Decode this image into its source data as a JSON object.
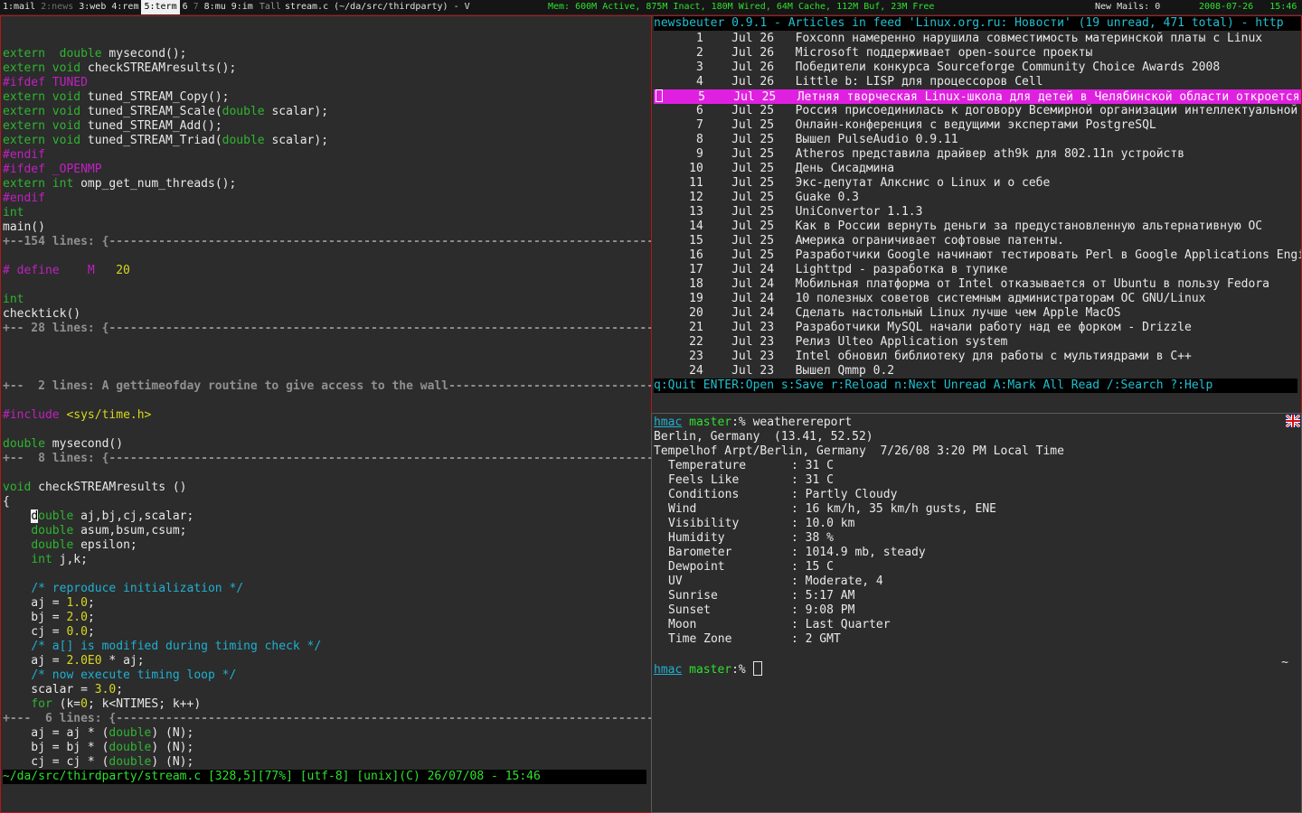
{
  "topbar": {
    "tags": [
      {
        "label": "1:mail",
        "state": "normal"
      },
      {
        "label": "2:news",
        "state": "dim"
      },
      {
        "label": "3:web",
        "state": "normal"
      },
      {
        "label": "4:rem",
        "state": "normal"
      },
      {
        "label": "5:term",
        "state": "active"
      },
      {
        "label": "6",
        "state": "normal"
      },
      {
        "label": "7",
        "state": "dim"
      },
      {
        "label": "8:mu",
        "state": "normal"
      },
      {
        "label": "9:im",
        "state": "normal"
      }
    ],
    "layout": "Tall",
    "window_title": "stream.c (~/da/src/thirdparty) - V",
    "memory": "Mem: 600M Active, 875M Inact, 180M Wired, 64M Cache, 112M Buf, 23M Free",
    "mails": "New Mails:  0",
    "date": "2008-07-26",
    "time": "15:46"
  },
  "editor": {
    "lines": [
      [],
      [
        [
          "kw",
          "extern"
        ],
        [
          "",
          "  "
        ],
        [
          "kw",
          "double"
        ],
        [
          "",
          " mysecond();"
        ]
      ],
      [
        [
          "kw",
          "extern"
        ],
        [
          "",
          " "
        ],
        [
          "kw",
          "void"
        ],
        [
          "",
          " checkSTREAMresults();"
        ]
      ],
      [
        [
          "pp",
          "#ifdef TUNED"
        ]
      ],
      [
        [
          "kw",
          "extern"
        ],
        [
          "",
          " "
        ],
        [
          "kw",
          "void"
        ],
        [
          "",
          " tuned_STREAM_Copy();"
        ]
      ],
      [
        [
          "kw",
          "extern"
        ],
        [
          "",
          " "
        ],
        [
          "kw",
          "void"
        ],
        [
          "",
          " tuned_STREAM_Scale("
        ],
        [
          "kw",
          "double"
        ],
        [
          "",
          " scalar);"
        ]
      ],
      [
        [
          "kw",
          "extern"
        ],
        [
          "",
          " "
        ],
        [
          "kw",
          "void"
        ],
        [
          "",
          " tuned_STREAM_Add();"
        ]
      ],
      [
        [
          "kw",
          "extern"
        ],
        [
          "",
          " "
        ],
        [
          "kw",
          "void"
        ],
        [
          "",
          " tuned_STREAM_Triad("
        ],
        [
          "kw",
          "double"
        ],
        [
          "",
          " scalar);"
        ]
      ],
      [
        [
          "pp",
          "#endif"
        ]
      ],
      [
        [
          "pp",
          "#ifdef _OPENMP"
        ]
      ],
      [
        [
          "kw",
          "extern"
        ],
        [
          "",
          " "
        ],
        [
          "kw",
          "int"
        ],
        [
          "",
          " omp_get_num_threads();"
        ]
      ],
      [
        [
          "pp",
          "#endif"
        ]
      ],
      [
        [
          "kw",
          "int"
        ]
      ],
      [
        [
          "",
          "main()"
        ]
      ],
      [
        [
          "fold",
          "+--154 lines: {-----------------------------------------------------------------------------------"
        ]
      ],
      [],
      [
        [
          "pp",
          "# define    M   "
        ],
        [
          "num",
          "20"
        ]
      ],
      [],
      [
        [
          "kw",
          "int"
        ]
      ],
      [
        [
          "",
          "checktick()"
        ]
      ],
      [
        [
          "fold",
          "+-- 28 lines: {-----------------------------------------------------------------------------------"
        ]
      ],
      [],
      [],
      [],
      [
        [
          "fold",
          "+--  2 lines: A gettimeofday routine to give access to the wall-----------------------------------"
        ]
      ],
      [],
      [
        [
          "pp",
          "#include "
        ],
        [
          "num",
          "<sys/time.h>"
        ]
      ],
      [],
      [
        [
          "kw",
          "double"
        ],
        [
          "",
          " mysecond()"
        ]
      ],
      [
        [
          "fold",
          "+--  8 lines: {-----------------------------------------------------------------------------------"
        ]
      ],
      [],
      [
        [
          "kw",
          "void"
        ],
        [
          "",
          " checkSTREAMresults ()"
        ]
      ],
      [
        [
          "",
          "{"
        ]
      ],
      [
        [
          "",
          "    "
        ],
        [
          "cursor",
          "d"
        ],
        [
          "kw",
          "ouble"
        ],
        [
          "",
          " aj,bj,cj,scalar;"
        ]
      ],
      [
        [
          "",
          "    "
        ],
        [
          "kw",
          "double"
        ],
        [
          "",
          " asum,bsum,csum;"
        ]
      ],
      [
        [
          "",
          "    "
        ],
        [
          "kw",
          "double"
        ],
        [
          "",
          " epsilon;"
        ]
      ],
      [
        [
          "",
          "    "
        ],
        [
          "kw",
          "int"
        ],
        [
          "",
          " j,k;"
        ]
      ],
      [],
      [
        [
          "",
          "    "
        ],
        [
          "cm",
          "/* reproduce initialization */"
        ]
      ],
      [
        [
          "",
          "    aj = "
        ],
        [
          "num",
          "1.0"
        ],
        [
          "",
          ";"
        ]
      ],
      [
        [
          "",
          "    bj = "
        ],
        [
          "num",
          "2.0"
        ],
        [
          "",
          ";"
        ]
      ],
      [
        [
          "",
          "    cj = "
        ],
        [
          "num",
          "0.0"
        ],
        [
          "",
          ";"
        ]
      ],
      [
        [
          "",
          "    "
        ],
        [
          "cm",
          "/* a[] is modified during timing check */"
        ]
      ],
      [
        [
          "",
          "    aj = "
        ],
        [
          "num",
          "2.0E0"
        ],
        [
          "",
          " * aj;"
        ]
      ],
      [
        [
          "",
          "    "
        ],
        [
          "cm",
          "/* now execute timing loop */"
        ]
      ],
      [
        [
          "",
          "    scalar = "
        ],
        [
          "num",
          "3.0"
        ],
        [
          "",
          ";"
        ]
      ],
      [
        [
          "",
          "    "
        ],
        [
          "kw",
          "for"
        ],
        [
          "",
          " (k="
        ],
        [
          "num",
          "0"
        ],
        [
          "",
          "; k<NTIMES; k++)"
        ]
      ],
      [
        [
          "fold",
          "+---  6 lines: {----------------------------------------------------------------------------------"
        ]
      ],
      [
        [
          "",
          "    aj = aj * ("
        ],
        [
          "kw",
          "double"
        ],
        [
          "",
          ") (N);"
        ]
      ],
      [
        [
          "",
          "    bj = bj * ("
        ],
        [
          "kw",
          "double"
        ],
        [
          "",
          ") (N);"
        ]
      ],
      [
        [
          "",
          "    cj = cj * ("
        ],
        [
          "kw",
          "double"
        ],
        [
          "",
          ") (N);"
        ]
      ]
    ],
    "statusline": "~/da/src/thirdparty/stream.c [328,5][77%] [utf-8] [unix](C) 26/07/08 - 15:46"
  },
  "newsbeuter": {
    "title": "newsbeuter 0.9.1 - Articles in feed 'Linux.org.ru: Новости' (19 unread, 471 total) - http",
    "articles": [
      {
        "n": "1",
        "date": "Jul 26",
        "title": "Foxconn намеренно нарушила совместимость материнской платы с Linux"
      },
      {
        "n": "2",
        "date": "Jul 26",
        "title": "Microsoft поддерживает open-source проекты"
      },
      {
        "n": "3",
        "date": "Jul 26",
        "title": "Победители конкурса Sourceforge Community Choice Awards 2008"
      },
      {
        "n": "4",
        "date": "Jul 26",
        "title": "Little b: LISP для процессоров Cell"
      },
      {
        "n": "5",
        "date": "Jul 25",
        "title": "Летняя творческая Linux-школа для детей в Челябинской области откроется"
      },
      {
        "n": "6",
        "date": "Jul 25",
        "title": "Россия присоединилась к договору Всемирной организации интеллектуальной"
      },
      {
        "n": "7",
        "date": "Jul 25",
        "title": "Онлайн-конференция с ведущими экспертами PostgreSQL"
      },
      {
        "n": "8",
        "date": "Jul 25",
        "title": "Вышел PulseAudio 0.9.11"
      },
      {
        "n": "9",
        "date": "Jul 25",
        "title": "Atheros представила драйвер ath9k для 802.11n устройств"
      },
      {
        "n": "10",
        "date": "Jul 25",
        "title": "День Сисадмина"
      },
      {
        "n": "11",
        "date": "Jul 25",
        "title": "Экс-депутат Алкснис о Linux и о себе"
      },
      {
        "n": "12",
        "date": "Jul 25",
        "title": "Guake 0.3"
      },
      {
        "n": "13",
        "date": "Jul 25",
        "title": "UniConvertor 1.1.3"
      },
      {
        "n": "14",
        "date": "Jul 25",
        "title": "Как в России вернуть деньги за предустановленную альтернативную ОС"
      },
      {
        "n": "15",
        "date": "Jul 25",
        "title": "Америка ограничивает софтовые патенты."
      },
      {
        "n": "16",
        "date": "Jul 25",
        "title": "Разработчики Google начинают тестировать Perl в Google Applications Engi"
      },
      {
        "n": "17",
        "date": "Jul 24",
        "title": "Lighttpd - разработка в тупике"
      },
      {
        "n": "18",
        "date": "Jul 24",
        "title": "Мобильная платформа от Intel отказывается от Ubuntu в пользу Fedora"
      },
      {
        "n": "19",
        "date": "Jul 24",
        "title": "10 полезных советов системным администраторам ОС GNU/Linux"
      },
      {
        "n": "20",
        "date": "Jul 24",
        "title": "Сделать настольный Linux лучше чем Apple MacOS"
      },
      {
        "n": "21",
        "date": "Jul 23",
        "title": "Разработчики MySQL начали работу над ее форком - Drizzle"
      },
      {
        "n": "22",
        "date": "Jul 23",
        "title": "Релиз Ulteo Application system"
      },
      {
        "n": "23",
        "date": "Jul 23",
        "title": "Intel обновил библиотеку для работы с мультиядрами в C++"
      },
      {
        "n": "24",
        "date": "Jul 23",
        "title": "Вышел Qmmp 0.2"
      }
    ],
    "selected_index": 4,
    "help": "q:Quit ENTER:Open s:Save r:Reload n:Next Unread A:Mark All Read /:Search ?:Help"
  },
  "terminal": {
    "user": "hmac",
    "host": "master",
    "prompt_sep": ":% ",
    "command": "weatherereport",
    "location": "Berlin, Germany  (13.41, 52.52)",
    "station": "Tempelhof Arpt/Berlin, Germany  7/26/08 3:20 PM Local Time",
    "report": [
      {
        "label": "Temperature",
        "value": "31 C"
      },
      {
        "label": "Feels Like",
        "value": "31 C"
      },
      {
        "label": "Conditions",
        "value": "Partly Cloudy"
      },
      {
        "label": "Wind",
        "value": "16 km/h, 35 km/h gusts, ENE"
      },
      {
        "label": "Visibility",
        "value": "10.0 km"
      },
      {
        "label": "Humidity",
        "value": "38 %"
      },
      {
        "label": "Barometer",
        "value": "1014.9 mb, steady"
      },
      {
        "label": "Dewpoint",
        "value": "15 C"
      },
      {
        "label": "UV",
        "value": "Moderate, 4"
      },
      {
        "label": "Sunrise",
        "value": "5:17 AM"
      },
      {
        "label": "Sunset",
        "value": "9:08 PM"
      },
      {
        "label": "Moon",
        "value": "Last Quarter"
      },
      {
        "label": "Time Zone",
        "value": "2 GMT"
      }
    ],
    "cwd_indicator": "~",
    "flag_icon": "uk-flag-icon"
  }
}
